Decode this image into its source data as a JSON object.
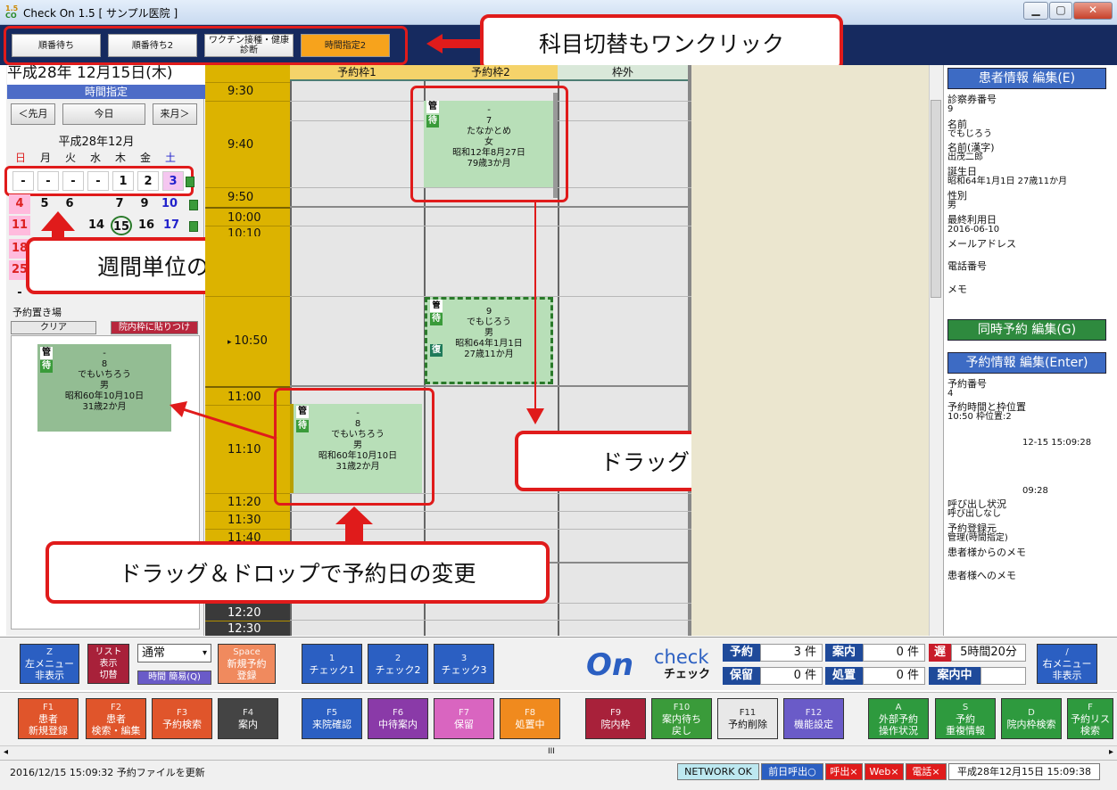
{
  "window": {
    "logo_top": "1.5",
    "logo_bottom": "CO",
    "title": "Check On 1.5 [ サンプル医院 ]",
    "min": "▁",
    "max": "▢",
    "close": "✕"
  },
  "subjects": [
    {
      "label": "順番待ち"
    },
    {
      "label": "順番待ち2"
    },
    {
      "label": "ワクチン接種・健康\n診断"
    },
    {
      "label": "時間指定2"
    }
  ],
  "callouts": {
    "subjects": "科目切替もワンクリック",
    "week": "週間単位の予約を確認",
    "move": "ドラッグ＆ドロップで予約の移動",
    "change_day": "ドラッグ＆ドロップで予約日の変更"
  },
  "left": {
    "date": "平成28年 12月15日(木)",
    "mode": "時間指定",
    "prev": "＜先月",
    "today": "今日",
    "next": "来月＞",
    "month": "平成28年12月",
    "dow": [
      "日",
      "月",
      "火",
      "水",
      "木",
      "金",
      "土"
    ],
    "week": [
      "-",
      "-",
      "-",
      "-",
      "1",
      "2",
      "3"
    ],
    "rows": [
      [
        "4",
        "5",
        "6",
        "7",
        "8",
        "9",
        "10"
      ],
      [
        "11",
        "12",
        "13",
        "14",
        "15",
        "16",
        "17"
      ],
      [
        "18",
        "",
        "",
        "",
        "",
        "",
        ""
      ],
      [
        "25",
        "",
        "",
        "",
        "",
        "",
        ""
      ],
      [
        "-",
        "",
        "",
        "",
        "",
        "",
        ""
      ]
    ],
    "park_label": "予約置き場",
    "clear": "クリア",
    "paste": "院内枠に貼りつけ"
  },
  "columns": [
    "予約枠1",
    "予約枠2",
    "枠外"
  ],
  "times": [
    {
      "t": "9:30"
    },
    {
      "t": "9:40"
    },
    {
      "t": "9:50"
    },
    {
      "t": "10:00"
    },
    {
      "t": "10:10"
    },
    {
      "t": "10:50"
    },
    {
      "t": "11:00"
    },
    {
      "t": "11:10"
    },
    {
      "t": "11:20"
    },
    {
      "t": "11:30"
    },
    {
      "t": "11:40"
    },
    {
      "t": "12:20"
    },
    {
      "t": "12:30"
    }
  ],
  "tags": {
    "kan": "管",
    "mach": "待",
    "fuku": "復"
  },
  "cards": {
    "a": {
      "dash": "-",
      "no": "7",
      "name": "たなかとめ",
      "sex": "女",
      "dob": "昭和12年8月27日",
      "age": "79歳3か月"
    },
    "b": {
      "dash": "-",
      "no": "9",
      "name": "でもじろう",
      "sex": "男",
      "dob": "昭和64年1月1日",
      "age": "27歳11か月"
    },
    "c": {
      "dash": "-",
      "no": "8",
      "name": "でもいちろう",
      "sex": "男",
      "dob": "昭和60年10月10日",
      "age": "31歳2か月"
    }
  },
  "right": {
    "patient_btn": "患者情報 編集(E)",
    "same_btn": "同時予約 編集(G)",
    "resv_btn": "予約情報 編集(Enter)",
    "fields": [
      {
        "l": "診察券番号",
        "v": "9"
      },
      {
        "l": "名前",
        "v": "でもじろう"
      },
      {
        "l": "名前(漢字)",
        "v": "出茂二郎"
      },
      {
        "l": "誕生日",
        "v": "昭和64年1月1日 27歳11か月"
      },
      {
        "l": "性別",
        "v": "男"
      },
      {
        "l": "最終利用日",
        "v": "2016-06-10"
      },
      {
        "l": "メールアドレス",
        "v": ""
      },
      {
        "l": "電話番号",
        "v": ""
      },
      {
        "l": "メモ",
        "v": ""
      }
    ],
    "rfields": [
      {
        "l": "予約番号",
        "v": "4"
      },
      {
        "l": "予約時間と枠位置",
        "v": "10:50 枠位置:2"
      },
      {
        "l": "",
        "v": "12-15 15:09:28"
      },
      {
        "l": "",
        "v": "09:28"
      },
      {
        "l": "呼び出し状況",
        "v": "呼び出しなし"
      },
      {
        "l": "予約登録元",
        "v": "管理(時間指定)"
      },
      {
        "l": "患者様からのメモ",
        "v": ""
      },
      {
        "l": "患者様へのメモ",
        "v": ""
      }
    ]
  },
  "bottom1": {
    "z_key": "Z",
    "z": "左メニュー\n非表示",
    "list": "リスト\n表示\n切替",
    "mode_sel": "通常",
    "mode_arrow": "▾",
    "time_btn": "時間 簡易(Q)",
    "space_key": "Space",
    "space": "新規予約\n登録",
    "checks": [
      {
        "k": "1",
        "l": "チェック1"
      },
      {
        "k": "2",
        "l": "チェック2"
      },
      {
        "k": "3",
        "l": "チェック3"
      }
    ],
    "brand_on": "On",
    "brand_check": "check",
    "brand_jp": "チェック",
    "counts": [
      {
        "l": "予約",
        "v": "3 件"
      },
      {
        "l": "案内",
        "v": "0 件"
      },
      {
        "l": "保留",
        "v": "0 件"
      },
      {
        "l": "処置",
        "v": "0 件"
      }
    ],
    "late": "遅",
    "late_val": "5時間20分",
    "guiding": "案内中",
    "right_key": "/",
    "right_menu": "右メニュー\n非表示"
  },
  "fkeys": [
    {
      "k": "F1",
      "l": "患者\n新規登録",
      "c": "#e0552b"
    },
    {
      "k": "F2",
      "l": "患者\n検索・編集",
      "c": "#e0552b"
    },
    {
      "k": "F3",
      "l": "予約検索",
      "c": "#e0552b"
    },
    {
      "k": "F4",
      "l": "案内",
      "c": "#444444"
    },
    {
      "k": "F5",
      "l": "来院確認",
      "c": "#2b5fc2"
    },
    {
      "k": "F6",
      "l": "中待案内",
      "c": "#8a3aa8"
    },
    {
      "k": "F7",
      "l": "保留",
      "c": "#d965c0"
    },
    {
      "k": "F8",
      "l": "処置中",
      "c": "#f08a1e"
    },
    {
      "k": "F9",
      "l": "院内枠",
      "c": "#a8213a"
    },
    {
      "k": "F10",
      "l": "案内待ち\n戻し",
      "c": "#3a9b3a"
    },
    {
      "k": "F11",
      "l": "予約削除",
      "c": "#e8e8e8"
    },
    {
      "k": "F12",
      "l": "機能設定",
      "c": "#6a5bc8"
    },
    {
      "k": "A",
      "l": "外部予約\n操作状況",
      "c": "#2e9a3e"
    },
    {
      "k": "S",
      "l": "予約\n重複情報",
      "c": "#2e9a3e"
    },
    {
      "k": "D",
      "l": "院内枠検索",
      "c": "#2e9a3e"
    },
    {
      "k": "F",
      "l": "予約リス\n検索",
      "c": "#2e9a3e"
    }
  ],
  "scroll": {
    "left": "◂",
    "right": "▸",
    "mid": "III"
  },
  "status": {
    "msg": "2016/12/15 15:09:32 予約ファイルを更新",
    "net": "NETWORK OK",
    "prev_call": "前日呼出○",
    "call": "呼出×",
    "web": "Web×",
    "tel": "電話×",
    "clock": "平成28年12月15日 15:09:38"
  }
}
